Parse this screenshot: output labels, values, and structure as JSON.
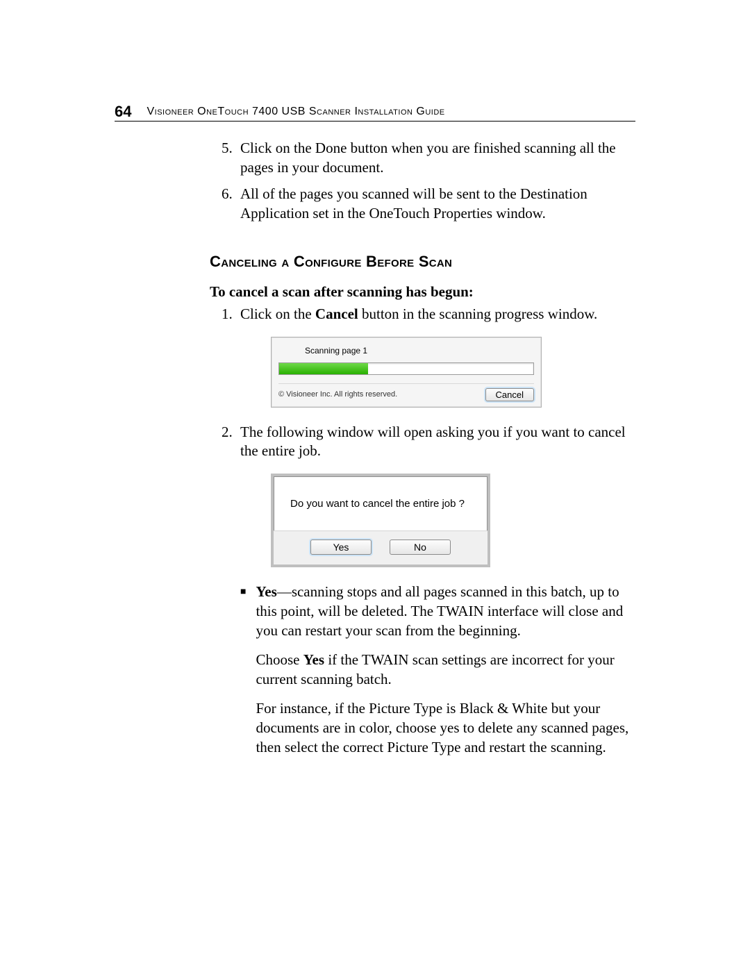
{
  "header": {
    "page_number": "64",
    "title": "Visioneer OneTouch 7400 USB Scanner Installation Guide"
  },
  "steps_continued": {
    "start": 5,
    "items": [
      "Click on the Done button when you are finished scanning all the pages in your document.",
      "All of the pages you scanned will be sent to the Destination Application set in the OneTouch Properties window."
    ]
  },
  "section_heading": "Canceling a Configure Before Scan",
  "sub_heading": "To cancel a scan after scanning has begun:",
  "cancel_steps": {
    "step1_prefix": "Click on the ",
    "step1_bold": "Cancel",
    "step1_suffix": " button in the scanning progress window.",
    "step2": "The following window will open asking you if you want to cancel the entire job."
  },
  "progress_dialog": {
    "label": "Scanning page 1",
    "copyright": "© Visioneer Inc. All rights reserved.",
    "cancel_label": "Cancel"
  },
  "confirm_dialog": {
    "message": "Do you want to cancel the entire job ?",
    "yes_label": "Yes",
    "no_label": "No"
  },
  "bullet": {
    "lead_bold": "Yes",
    "lead_rest": "—scanning stops and all pages scanned in this batch, up to this point, will be deleted. The TWAIN interface will close and you can restart your scan from the beginning.",
    "para2_pre": "Choose ",
    "para2_bold": "Yes",
    "para2_post": " if the TWAIN scan settings are incorrect for your current scanning batch.",
    "para3": "For instance, if the Picture Type is Black & White but your documents are in color, choose yes to delete any scanned pages, then select the correct Picture Type and restart the scanning."
  }
}
